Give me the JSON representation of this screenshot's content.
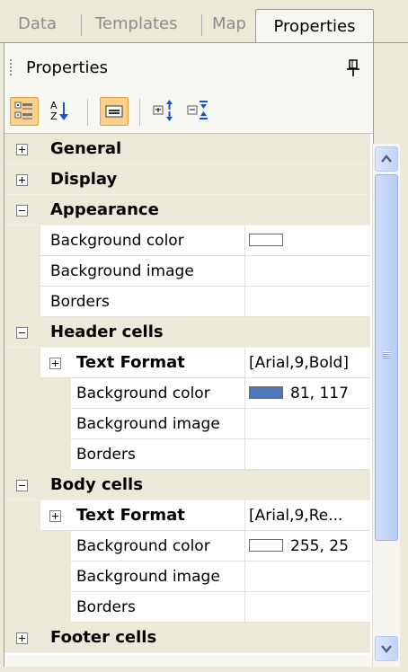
{
  "tabs": [
    "Data",
    "Templates",
    "Map",
    "Properties"
  ],
  "active_tab": "Properties",
  "panel": {
    "title": "Properties",
    "pin_icon": "pin-icon"
  },
  "toolbar": {
    "buttons": [
      {
        "icon": "categorized-icon",
        "active": true
      },
      {
        "icon": "alphabetical-sort-icon",
        "active": false
      },
      {
        "icon": "property-pages-icon",
        "active": true
      },
      {
        "icon": "expand-all-icon",
        "active": false
      },
      {
        "icon": "collapse-all-icon",
        "active": false
      }
    ]
  },
  "grid": {
    "rows": [
      {
        "type": "category",
        "label": "General",
        "expanded": false
      },
      {
        "type": "category",
        "label": "Display",
        "expanded": false
      },
      {
        "type": "category",
        "label": "Appearance",
        "expanded": true
      },
      {
        "type": "property",
        "name": "Background color",
        "value": "",
        "swatch": "#ffffff",
        "level": 1
      },
      {
        "type": "property",
        "name": "Background image",
        "value": "",
        "level": 1
      },
      {
        "type": "property",
        "name": "Borders",
        "value": "",
        "level": 1
      },
      {
        "type": "category",
        "label": "Header cells",
        "expanded": true
      },
      {
        "type": "subcategory",
        "name": "Text Format",
        "value": "[Arial,9,Bold]",
        "expanded": false
      },
      {
        "type": "property",
        "name": "Background color",
        "value": "81, 117",
        "swatch": "#5175b9",
        "level": 2
      },
      {
        "type": "property",
        "name": "Background image",
        "value": "",
        "level": 2
      },
      {
        "type": "property",
        "name": "Borders",
        "value": "",
        "level": 2
      },
      {
        "type": "category",
        "label": "Body cells",
        "expanded": true
      },
      {
        "type": "subcategory",
        "name": "Text Format",
        "value": "[Arial,9,Re...",
        "expanded": false
      },
      {
        "type": "property",
        "name": "Background color",
        "value": "255, 25",
        "swatch": "#ffffff",
        "level": 2
      },
      {
        "type": "property",
        "name": "Background image",
        "value": "",
        "level": 2
      },
      {
        "type": "property",
        "name": "Borders",
        "value": "",
        "level": 2
      },
      {
        "type": "category",
        "label": "Footer cells",
        "expanded": false
      }
    ]
  },
  "scrollbar": {
    "up_icon": "chevron-up-icon",
    "down_icon": "chevron-down-icon"
  },
  "colors": {
    "accent": "#fbd08c",
    "scroll": "#c3d3f7"
  }
}
